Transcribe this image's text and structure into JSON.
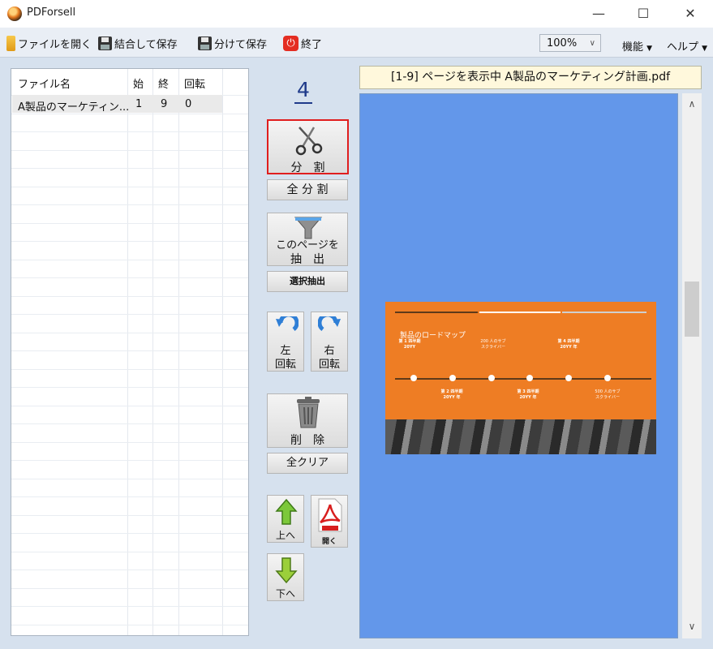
{
  "window": {
    "title": "PDForsell",
    "min": "—",
    "max": "☐",
    "close": "✕"
  },
  "menu": {
    "open": "ファイルを開く",
    "merge_save": "結合して保存",
    "split_save": "分けて保存",
    "exit": "終了",
    "zoom": "100%",
    "features": "機能",
    "help": "ヘルプ"
  },
  "file_list": {
    "columns": [
      "ファイル名",
      "始",
      "終",
      "回転"
    ],
    "rows": [
      {
        "name": "A製品のマーケティン...",
        "start": "1",
        "end": "9",
        "rotation": "0"
      }
    ]
  },
  "tools": {
    "page_number": "4",
    "split": "分　割",
    "split_all": "全 分 割",
    "extract_line1": "このページを",
    "extract_line2": "抽　出",
    "extract_selected": "選択抽出",
    "rotate_left_1": "左",
    "rotate_left_2": "回転",
    "rotate_right_1": "右",
    "rotate_right_2": "回転",
    "delete": "削　除",
    "clear_all": "全クリア",
    "move_up": "上へ",
    "open_pdf": "開く",
    "move_down": "下へ"
  },
  "preview": {
    "status": "[1-9] ページを表示中  A製品のマーケティング計画.pdf",
    "slide": {
      "title": "製品のロードマップ",
      "top_labels": [
        "第 1 四半期\n20YY",
        "200 人のサブ\nスクライバー",
        "第 4 四半期\n20YY 年"
      ],
      "bottom_labels": [
        "第 2 四半期\n20YY 年",
        "第 3 四半期\n20YY 年",
        "500 人のサブ\nスクライバー"
      ]
    }
  },
  "colors": {
    "preview_bg": "#6397ea",
    "slide_orange": "#ee7d24",
    "accent_red": "#e01e1e"
  }
}
